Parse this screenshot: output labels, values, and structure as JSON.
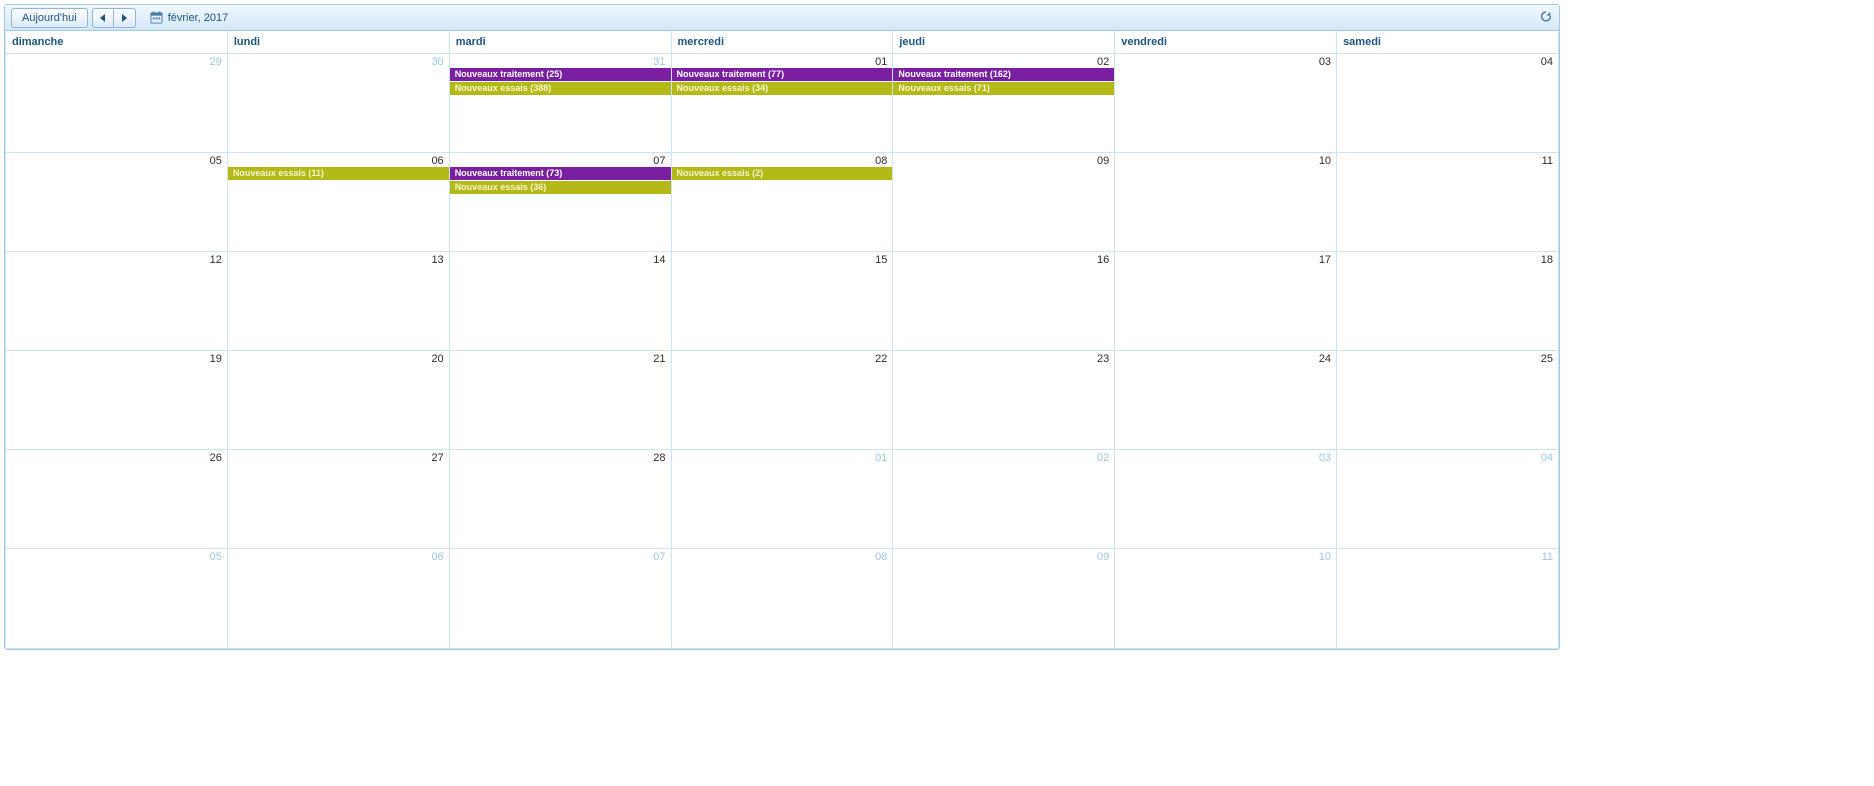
{
  "toolbar": {
    "today_label": "Aujourd'hui",
    "period_label": "février, 2017"
  },
  "day_headers": [
    "dimanche",
    "lundi",
    "mardi",
    "mercredi",
    "jeudi",
    "vendredi",
    "samedi"
  ],
  "event_types": {
    "traitement": {
      "label_prefix": "Nouveaux traitement",
      "color": "#7b1fa2"
    },
    "essais": {
      "label_prefix": "Nouveaux essais",
      "color": "#b5b918"
    }
  },
  "weeks": [
    [
      {
        "num": "29",
        "other_month": true,
        "events": []
      },
      {
        "num": "30",
        "other_month": true,
        "events": []
      },
      {
        "num": "31",
        "other_month": true,
        "events": [
          {
            "type": "traitement",
            "label": "Nouveaux traitement (25)"
          },
          {
            "type": "essais",
            "label": "Nouveaux essais (388)"
          }
        ]
      },
      {
        "num": "01",
        "other_month": false,
        "events": [
          {
            "type": "traitement",
            "label": "Nouveaux traitement (77)"
          },
          {
            "type": "essais",
            "label": "Nouveaux essais (34)"
          }
        ]
      },
      {
        "num": "02",
        "other_month": false,
        "events": [
          {
            "type": "traitement",
            "label": "Nouveaux traitement (162)"
          },
          {
            "type": "essais",
            "label": "Nouveaux essais (71)"
          }
        ]
      },
      {
        "num": "03",
        "other_month": false,
        "events": []
      },
      {
        "num": "04",
        "other_month": false,
        "events": []
      }
    ],
    [
      {
        "num": "05",
        "other_month": false,
        "events": []
      },
      {
        "num": "06",
        "other_month": false,
        "events": [
          {
            "type": "essais",
            "label": "Nouveaux essais (11)"
          }
        ]
      },
      {
        "num": "07",
        "other_month": false,
        "events": [
          {
            "type": "traitement",
            "label": "Nouveaux traitement (73)"
          },
          {
            "type": "essais",
            "label": "Nouveaux essais (36)"
          }
        ]
      },
      {
        "num": "08",
        "other_month": false,
        "events": [
          {
            "type": "essais",
            "label": "Nouveaux essais (2)"
          }
        ]
      },
      {
        "num": "09",
        "other_month": false,
        "events": []
      },
      {
        "num": "10",
        "other_month": false,
        "events": []
      },
      {
        "num": "11",
        "other_month": false,
        "events": []
      }
    ],
    [
      {
        "num": "12",
        "other_month": false,
        "events": []
      },
      {
        "num": "13",
        "other_month": false,
        "events": []
      },
      {
        "num": "14",
        "other_month": false,
        "events": []
      },
      {
        "num": "15",
        "other_month": false,
        "events": []
      },
      {
        "num": "16",
        "other_month": false,
        "events": []
      },
      {
        "num": "17",
        "other_month": false,
        "events": []
      },
      {
        "num": "18",
        "other_month": false,
        "events": []
      }
    ],
    [
      {
        "num": "19",
        "other_month": false,
        "events": []
      },
      {
        "num": "20",
        "other_month": false,
        "events": []
      },
      {
        "num": "21",
        "other_month": false,
        "events": []
      },
      {
        "num": "22",
        "other_month": false,
        "events": []
      },
      {
        "num": "23",
        "other_month": false,
        "events": []
      },
      {
        "num": "24",
        "other_month": false,
        "events": []
      },
      {
        "num": "25",
        "other_month": false,
        "events": []
      }
    ],
    [
      {
        "num": "26",
        "other_month": false,
        "events": []
      },
      {
        "num": "27",
        "other_month": false,
        "events": []
      },
      {
        "num": "28",
        "other_month": false,
        "events": []
      },
      {
        "num": "01",
        "other_month": true,
        "events": []
      },
      {
        "num": "02",
        "other_month": true,
        "events": []
      },
      {
        "num": "03",
        "other_month": true,
        "events": []
      },
      {
        "num": "04",
        "other_month": true,
        "events": []
      }
    ],
    [
      {
        "num": "05",
        "other_month": true,
        "events": []
      },
      {
        "num": "06",
        "other_month": true,
        "events": []
      },
      {
        "num": "07",
        "other_month": true,
        "events": []
      },
      {
        "num": "08",
        "other_month": true,
        "events": []
      },
      {
        "num": "09",
        "other_month": true,
        "events": []
      },
      {
        "num": "10",
        "other_month": true,
        "events": []
      },
      {
        "num": "11",
        "other_month": true,
        "events": []
      }
    ]
  ]
}
